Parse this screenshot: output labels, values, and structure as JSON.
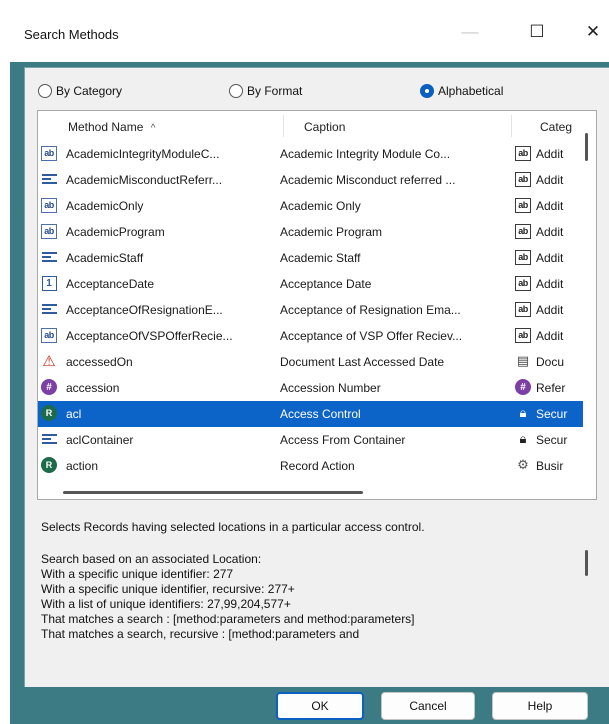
{
  "window": {
    "title": "Search Methods",
    "minimize_glyph": "—",
    "maximize_glyph": "☐",
    "close_glyph": "✕"
  },
  "view_mode": {
    "options": [
      {
        "label": "By Category",
        "selected": false
      },
      {
        "label": "By Format",
        "selected": false
      },
      {
        "label": "Alphabetical",
        "selected": true
      }
    ]
  },
  "list": {
    "columns": [
      "Method Name",
      "Caption",
      "Categ"
    ],
    "sort_glyph": "^",
    "rows": [
      {
        "icon": "text-field-icon",
        "name": "AcademicIntegrityModuleC...",
        "caption": "Academic Integrity Module Co...",
        "cat_icon": "text-field-icon",
        "category": "Addit"
      },
      {
        "icon": "list-icon",
        "name": "AcademicMisconductReferr...",
        "caption": "Academic Misconduct referred ...",
        "cat_icon": "text-field-icon",
        "category": "Addit"
      },
      {
        "icon": "text-field-icon",
        "name": "AcademicOnly",
        "caption": "Academic Only",
        "cat_icon": "text-field-icon",
        "category": "Addit"
      },
      {
        "icon": "text-field-icon",
        "name": "AcademicProgram",
        "caption": "Academic Program",
        "cat_icon": "text-field-icon",
        "category": "Addit"
      },
      {
        "icon": "list-icon",
        "name": "AcademicStaff",
        "caption": "Academic Staff",
        "cat_icon": "text-field-icon",
        "category": "Addit"
      },
      {
        "icon": "calendar-icon",
        "name": "AcceptanceDate",
        "caption": "Acceptance Date",
        "cat_icon": "text-field-icon",
        "category": "Addit"
      },
      {
        "icon": "list-icon",
        "name": "AcceptanceOfResignationE...",
        "caption": "Acceptance of Resignation Ema...",
        "cat_icon": "text-field-icon",
        "category": "Addit"
      },
      {
        "icon": "text-field-icon",
        "name": "AcceptanceOfVSPOfferRecie...",
        "caption": "Acceptance of VSP Offer Reciev...",
        "cat_icon": "text-field-icon",
        "category": "Addit"
      },
      {
        "icon": "warning-icon",
        "name": "accessedOn",
        "caption": "Document Last Accessed Date",
        "cat_icon": "document-icon",
        "category": "Docu"
      },
      {
        "icon": "hash-icon",
        "name": "accession",
        "caption": "Accession Number",
        "cat_icon": "hash-icon",
        "category": "Refer"
      },
      {
        "icon": "security-icon",
        "name": "acl",
        "caption": "Access Control",
        "cat_icon": "lock-icon",
        "category": "Secur",
        "selected": true
      },
      {
        "icon": "list-icon",
        "name": "aclContainer",
        "caption": "Access From Container",
        "cat_icon": "lock-icon",
        "category": "Secur"
      },
      {
        "icon": "security-icon",
        "name": "action",
        "caption": "Record Action",
        "cat_icon": "gear-icon",
        "category": "Busir"
      }
    ]
  },
  "description": {
    "lines": [
      "Selects Records having selected locations in a particular access control.",
      "",
      "Search based on an associated Location:",
      "With a specific unique identifier: 277",
      "With a specific unique identifier, recursive: 277+",
      "With a list of unique identifiers: 27,99,204,577+",
      "That matches a search : [method:parameters and method:parameters]",
      "That matches a search, recursive : [method:parameters and"
    ]
  },
  "buttons": {
    "ok": "OK",
    "cancel": "Cancel",
    "help": "Help"
  },
  "colors": {
    "frame": "#3c7b83",
    "selection": "#0c64c8",
    "accent": "#0a5fc0"
  }
}
